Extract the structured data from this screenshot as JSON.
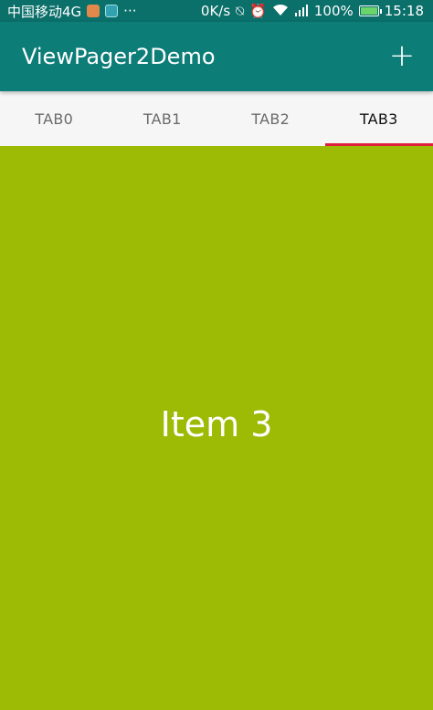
{
  "status_bar": {
    "carrier": "中国移动4G",
    "more": "···",
    "speed": "0K/s",
    "battery": "100%",
    "time": "15:18"
  },
  "app_bar": {
    "title": "ViewPager2Demo",
    "add_label": "+"
  },
  "tabs": [
    {
      "label": "TAB0",
      "selected": false
    },
    {
      "label": "TAB1",
      "selected": false
    },
    {
      "label": "TAB2",
      "selected": false
    },
    {
      "label": "TAB3",
      "selected": true
    }
  ],
  "page": {
    "text": "Item 3",
    "background": "#9dba05"
  },
  "colors": {
    "status_bar": "#0b6f6a",
    "app_bar": "#0d7d78",
    "tab_indicator": "#e0203a"
  }
}
